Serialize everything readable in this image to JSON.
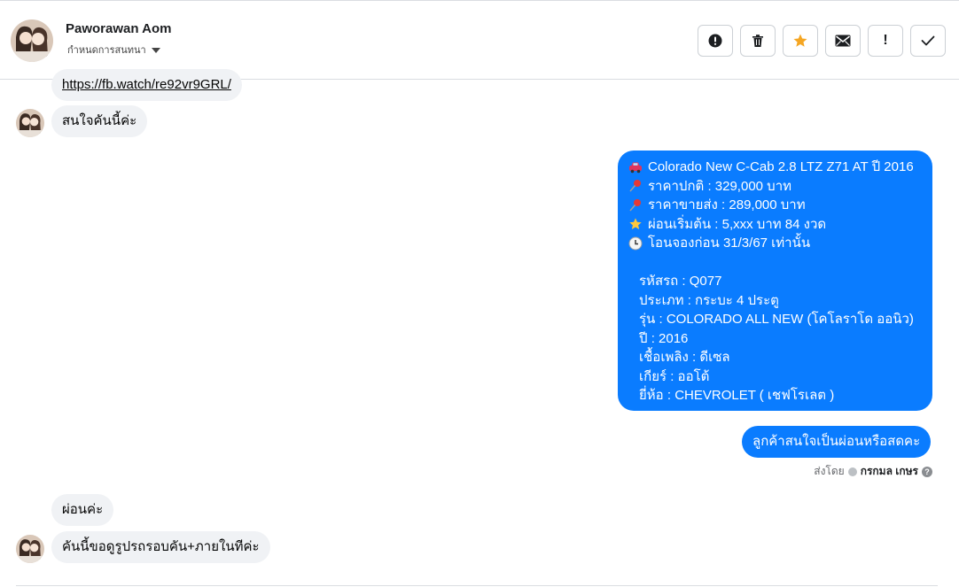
{
  "header": {
    "contact_name": "Paworawan Aom",
    "assign_label": "กำหนดการสนทนา",
    "actions": [
      {
        "icon": "alert-circle-icon",
        "label": ""
      },
      {
        "icon": "trash-icon",
        "label": ""
      },
      {
        "icon": "star-icon",
        "label": ""
      },
      {
        "icon": "envelope-icon",
        "label": ""
      },
      {
        "icon": "exclamation-icon",
        "label": "!"
      },
      {
        "icon": "check-icon",
        "label": ""
      }
    ]
  },
  "messages": {
    "link_text": "https://fb.watch/re92vr9GRL/",
    "interest_msg": "สนใจคันนี้ค่ะ",
    "listing": {
      "title": "Colorado New C-Cab 2.8 LTZ Z71 AT ปี 2016",
      "normal_price": "ราคาปกติ : 329,000 บาท",
      "wholesale_price": "ราคาขายส่ง : 289,000 บาท",
      "installment": "ผ่อนเริ่มต้น : 5,xxx บาท 84 งวด",
      "deadline": "โอนจองก่อน 31/3/67 เท่านั้น",
      "code": "รหัสรถ : Q077",
      "type": "ประเภท : กระบะ 4 ประตู",
      "model": "รุ่น : COLORADO ALL NEW (โคโลราโด ออนิว)",
      "year": "ปี : 2016",
      "fuel": "เชื้อเพลิง : ดีเซล",
      "gear": "เกียร์ : ออโต้",
      "brand": "ยี่ห้อ : CHEVROLET ( เชฟโรเลต )"
    },
    "question_msg": "ลูกค้าสนใจเป็นผ่อนหรือสดคะ",
    "sent_by_label": "ส่งโดย",
    "sent_by_agent": "กรกมล เกษร",
    "reply_1": "ผ่อนค่ะ",
    "reply_2": "คันนี้ขอดูรูปรถรอบคัน+ภายในทีค่ะ"
  },
  "colors": {
    "outgoing_bubble": "#0a7cff",
    "incoming_bubble": "#f0f2f5",
    "star_accent": "#f5a623"
  }
}
